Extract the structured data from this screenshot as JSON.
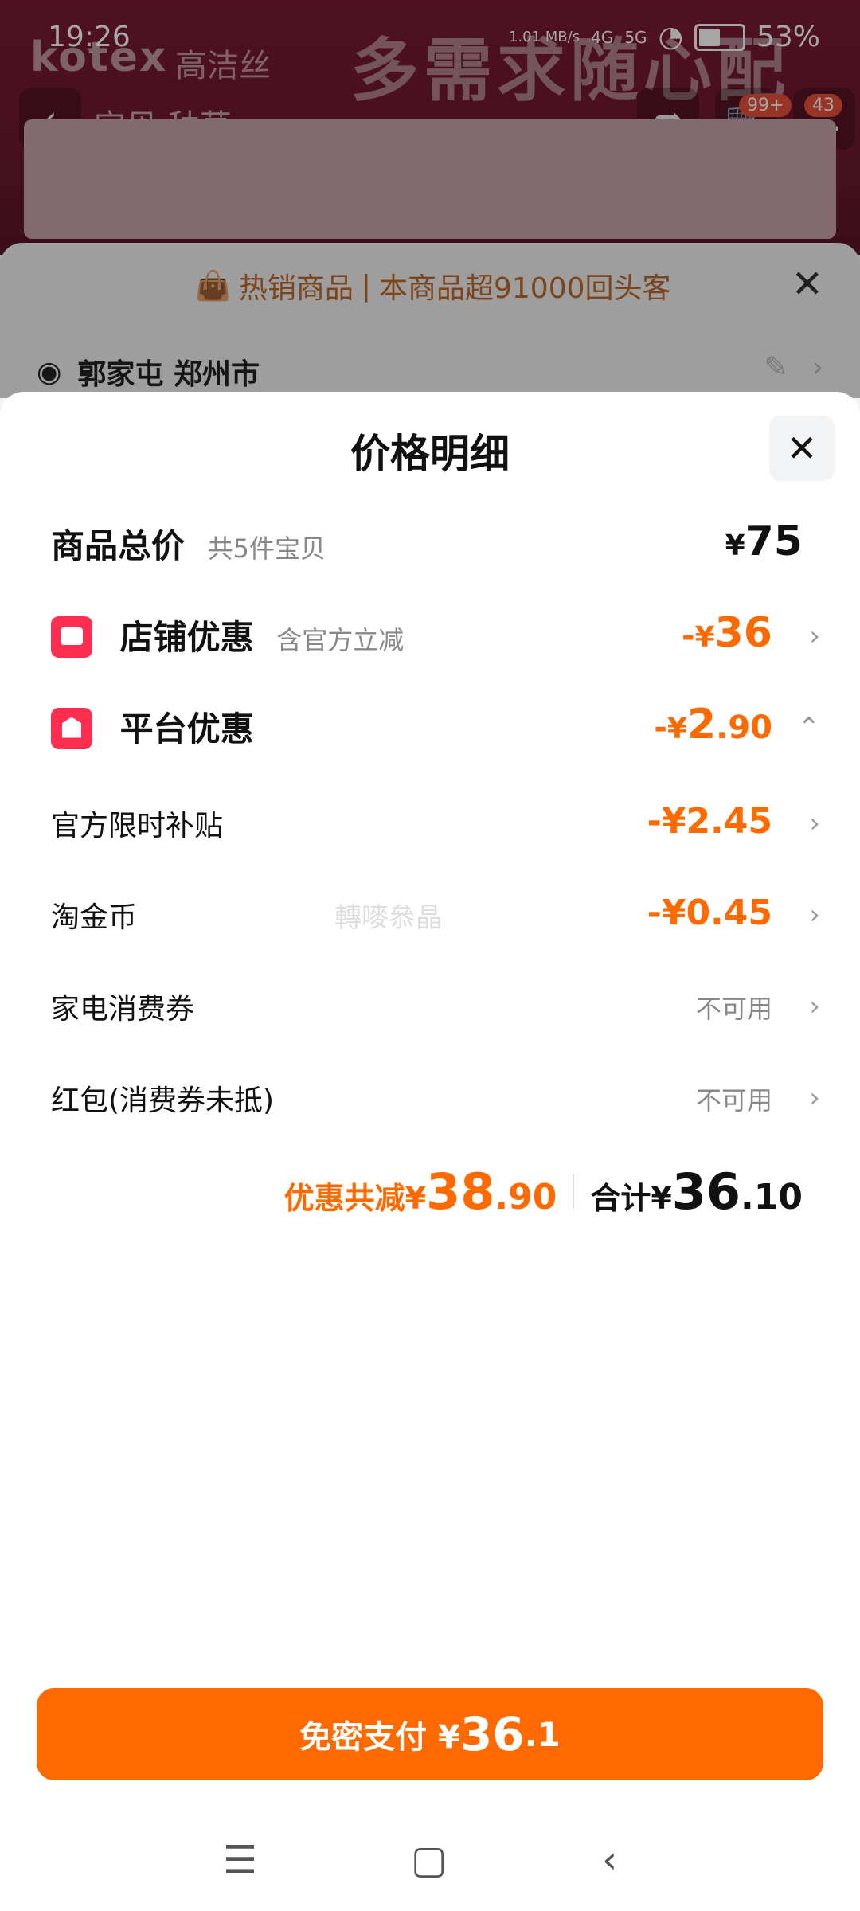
{
  "status": {
    "time": "19:26",
    "network_speed": "1.01 MB/s",
    "signal1": "4G",
    "signal2": "5G",
    "battery": "53%"
  },
  "background": {
    "brand": "kotex",
    "brand_cn": "高洁丝",
    "slogan": "多需求随心配",
    "nav_tabs": "宝贝  种草",
    "cart_badge": "99+",
    "msg_badge": "43"
  },
  "sheet": {
    "hot_label": "热销商品",
    "hot_desc": "本商品超91000回头客",
    "address": "郭家屯 郑州市"
  },
  "panel": {
    "title": "价格明细",
    "rows": {
      "total": {
        "label": "商品总价",
        "sub": "共5件宝贝",
        "yen": "¥",
        "amount": "75"
      },
      "shop": {
        "label": "店铺优惠",
        "sub": "含官方立减",
        "minus": "-",
        "yen": "¥",
        "amount": "36"
      },
      "platform": {
        "label": "平台优惠",
        "minus": "-",
        "yen": "¥",
        "int": "2",
        "dec": ".90"
      },
      "subsidy": {
        "label": "官方限时补贴",
        "value": "-¥2.45"
      },
      "coin": {
        "label": "淘金币",
        "value": "-¥0.45"
      },
      "appliance": {
        "label": "家电消费券",
        "status": "不可用"
      },
      "redpacket": {
        "label": "红包(消费券未抵)",
        "status": "不可用"
      }
    },
    "watermark": "轉嘜叅晶",
    "summary": {
      "discount_prefix": "优惠共减¥",
      "discount_int": "38",
      "discount_dec": ".90",
      "total_prefix": "合计¥",
      "total_int": "36",
      "total_dec": ".10"
    }
  },
  "pay_button": {
    "prefix": "免密支付 ¥",
    "int": "36",
    "dec": ".1"
  },
  "colors": {
    "accent": "#ff6a00",
    "badge": "#ff2d4f"
  }
}
